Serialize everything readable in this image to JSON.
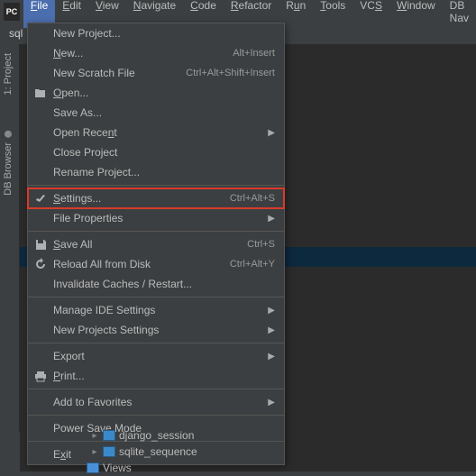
{
  "logo": "PC",
  "menubar": {
    "items": [
      {
        "label": "File",
        "mnemonic": 0,
        "active": true
      },
      {
        "label": "Edit",
        "mnemonic": 0
      },
      {
        "label": "View",
        "mnemonic": 0
      },
      {
        "label": "Navigate",
        "mnemonic": 0
      },
      {
        "label": "Code",
        "mnemonic": 0
      },
      {
        "label": "Refactor",
        "mnemonic": 0
      },
      {
        "label": "Run",
        "mnemonic": 1
      },
      {
        "label": "Tools",
        "mnemonic": 0
      },
      {
        "label": "VCS",
        "mnemonic": 2
      },
      {
        "label": "Window",
        "mnemonic": 0
      },
      {
        "label": "DB Nav",
        "mnemonic": -1
      }
    ]
  },
  "toolbar": {
    "label": "sql"
  },
  "side_tabs": {
    "project": "1: Project",
    "db_browser": "DB Browser"
  },
  "dropdown": {
    "groups": [
      [
        {
          "label": "New Project...",
          "icon": null
        },
        {
          "label": "New...",
          "icon": null,
          "mnemonic": 0,
          "shortcut": "Alt+Insert"
        },
        {
          "label": "New Scratch File",
          "icon": null,
          "shortcut": "Ctrl+Alt+Shift+Insert"
        },
        {
          "label": "Open...",
          "icon": "open",
          "mnemonic": 0
        },
        {
          "label": "Save As...",
          "icon": null
        },
        {
          "label": "Open Recent",
          "icon": null,
          "mnemonic": 9,
          "submenu": true
        },
        {
          "label": "Close Project",
          "icon": null
        },
        {
          "label": "Rename Project...",
          "icon": null
        }
      ],
      [
        {
          "label": "Settings...",
          "icon": "settings",
          "mnemonic": 0,
          "shortcut": "Ctrl+Alt+S",
          "highlighted": true
        },
        {
          "label": "File Properties",
          "icon": null,
          "submenu": true
        }
      ],
      [
        {
          "label": "Save All",
          "icon": "save",
          "mnemonic": 0,
          "shortcut": "Ctrl+S"
        },
        {
          "label": "Reload All from Disk",
          "icon": "reload",
          "shortcut": "Ctrl+Alt+Y"
        },
        {
          "label": "Invalidate Caches / Restart...",
          "icon": null
        }
      ],
      [
        {
          "label": "Manage IDE Settings",
          "icon": null,
          "submenu": true
        },
        {
          "label": "New Projects Settings",
          "icon": null,
          "submenu": true
        }
      ],
      [
        {
          "label": "Export",
          "icon": null,
          "submenu": true
        },
        {
          "label": "Print...",
          "icon": "print",
          "mnemonic": 0
        }
      ],
      [
        {
          "label": "Add to Favorites",
          "icon": null,
          "submenu": true
        }
      ],
      [
        {
          "label": "Power Save Mode",
          "icon": null
        }
      ],
      [
        {
          "label": "Exit",
          "icon": null,
          "mnemonic": 1
        }
      ]
    ]
  },
  "tree": {
    "rows": [
      {
        "label": "django_session",
        "icon": "db",
        "arrow": true
      },
      {
        "label": "sqlite_sequence",
        "icon": "db",
        "arrow": true
      },
      {
        "label": "Views",
        "icon": "view",
        "arrow": false
      }
    ]
  }
}
